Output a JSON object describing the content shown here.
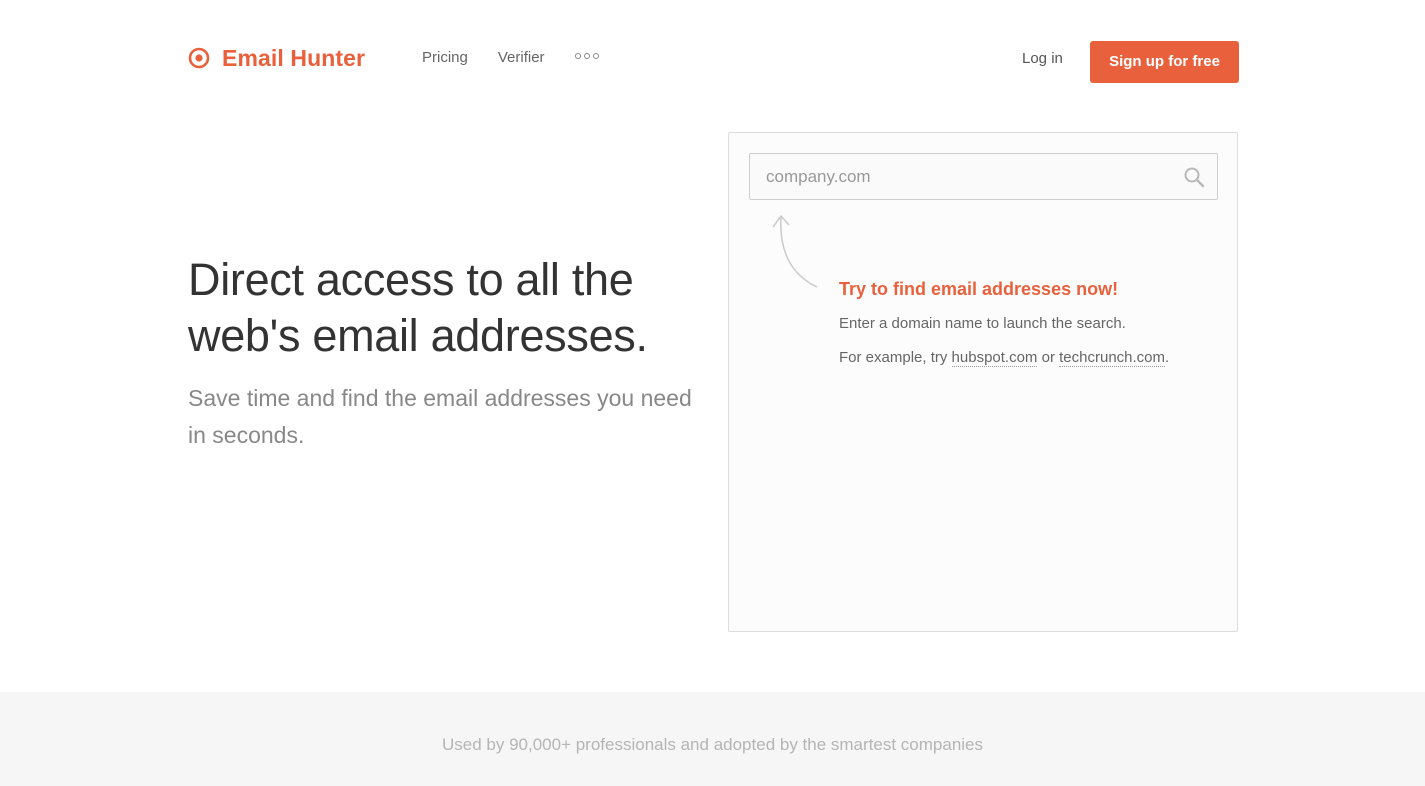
{
  "brand": {
    "name": "Email Hunter",
    "color": "#e8613c"
  },
  "nav": {
    "pricing": "Pricing",
    "verifier": "Verifier",
    "more_icon": "more-dots-icon"
  },
  "header": {
    "login": "Log in",
    "signup": "Sign up for free"
  },
  "hero": {
    "title": "Direct access to all the web's email addresses.",
    "subtitle": "Save time and find the email addresses you need in seconds."
  },
  "search": {
    "placeholder": "company.com",
    "value": "",
    "icon": "search-icon",
    "cta": "Try to find email addresses now!",
    "hint": "Enter a domain name to launch the search.",
    "example_prefix": "For example, try",
    "example_1": "hubspot.com",
    "example_or": "or",
    "example_2": "techcrunch.com",
    "example_suffix": "."
  },
  "band": {
    "text": "Used by 90,000+ professionals and adopted by the smartest companies"
  }
}
